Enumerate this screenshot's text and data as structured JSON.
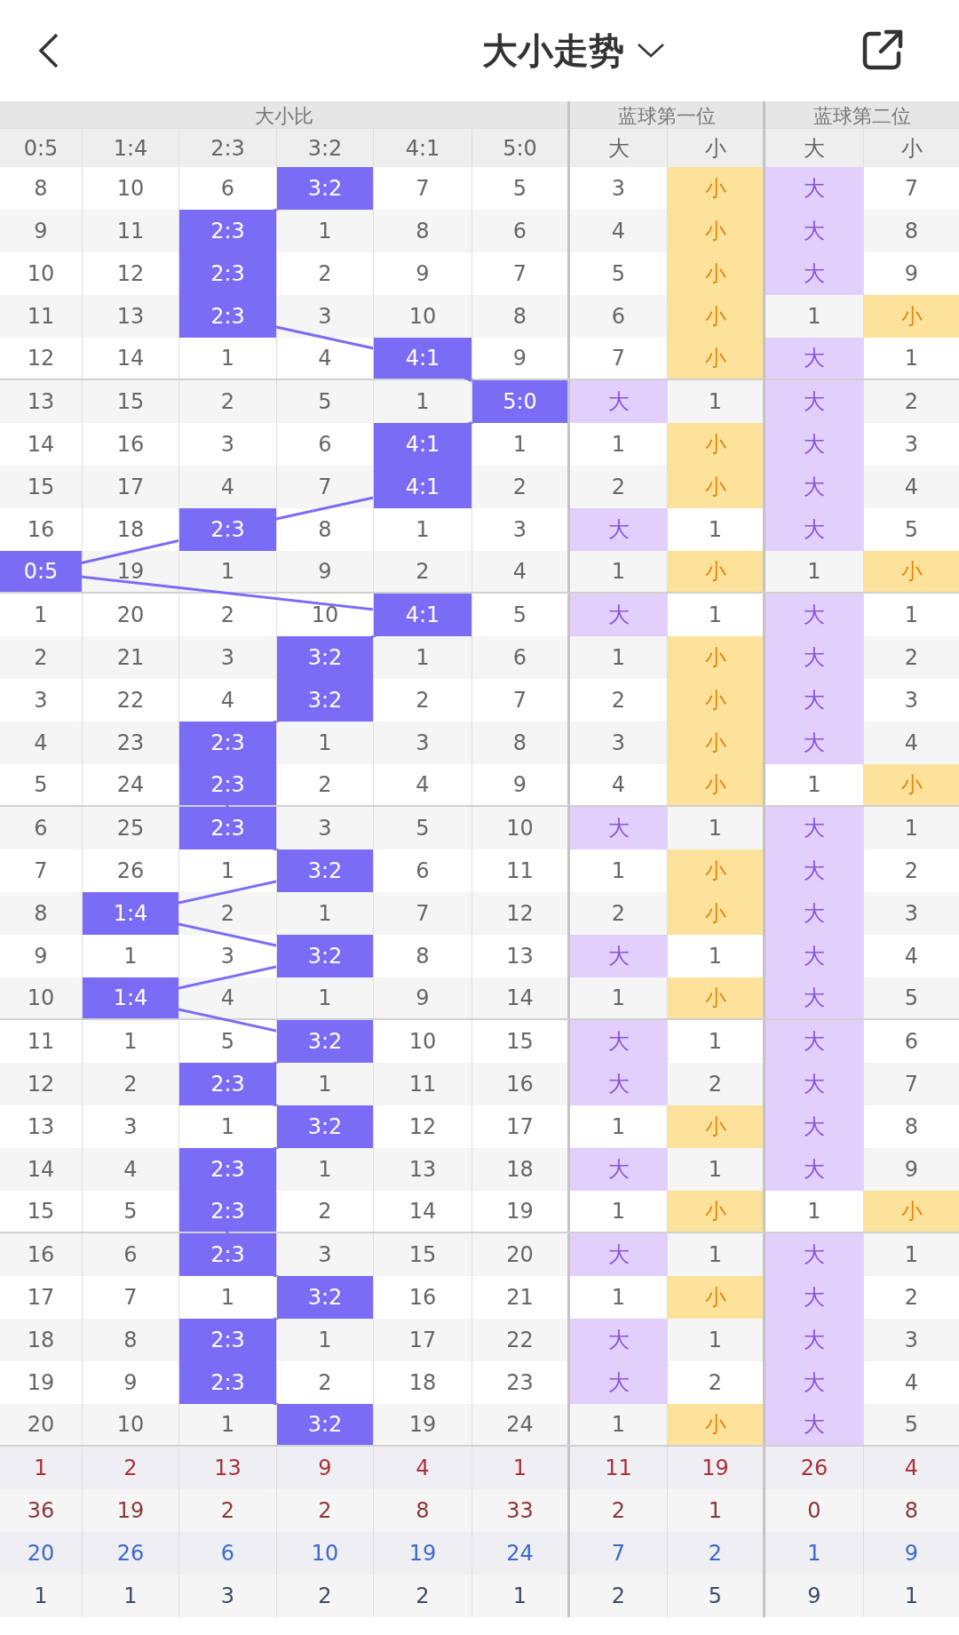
{
  "header": {
    "title": "大小走势"
  },
  "groups": [
    {
      "label": "大小比",
      "kind": "ratio"
    },
    {
      "label": "蓝球第一位",
      "kind": "position"
    },
    {
      "label": "蓝球第二位",
      "kind": "position"
    }
  ],
  "columns": [
    "0:5",
    "1:4",
    "2:3",
    "3:2",
    "4:1",
    "5:0",
    "大",
    "小",
    "大",
    "小"
  ],
  "rows": [
    {
      "cells": [
        "8",
        "10",
        "6",
        "3:2",
        "7",
        "5",
        "3",
        "小",
        "大",
        "7"
      ],
      "hits": [
        false,
        false,
        false,
        true,
        false,
        false,
        false,
        true,
        true,
        false
      ]
    },
    {
      "cells": [
        "9",
        "11",
        "2:3",
        "1",
        "8",
        "6",
        "4",
        "小",
        "大",
        "8"
      ],
      "hits": [
        false,
        false,
        true,
        false,
        false,
        false,
        false,
        true,
        true,
        false
      ]
    },
    {
      "cells": [
        "10",
        "12",
        "2:3",
        "2",
        "9",
        "7",
        "5",
        "小",
        "大",
        "9"
      ],
      "hits": [
        false,
        false,
        true,
        false,
        false,
        false,
        false,
        true,
        true,
        false
      ]
    },
    {
      "cells": [
        "11",
        "13",
        "2:3",
        "3",
        "10",
        "8",
        "6",
        "小",
        "1",
        "小"
      ],
      "hits": [
        false,
        false,
        true,
        false,
        false,
        false,
        false,
        true,
        false,
        true
      ]
    },
    {
      "cells": [
        "12",
        "14",
        "1",
        "4",
        "4:1",
        "9",
        "7",
        "小",
        "大",
        "1"
      ],
      "hits": [
        false,
        false,
        false,
        false,
        true,
        false,
        false,
        true,
        true,
        false
      ]
    },
    {
      "cells": [
        "13",
        "15",
        "2",
        "5",
        "1",
        "5:0",
        "大",
        "1",
        "大",
        "2"
      ],
      "hits": [
        false,
        false,
        false,
        false,
        false,
        true,
        true,
        false,
        true,
        false
      ]
    },
    {
      "cells": [
        "14",
        "16",
        "3",
        "6",
        "4:1",
        "1",
        "1",
        "小",
        "大",
        "3"
      ],
      "hits": [
        false,
        false,
        false,
        false,
        true,
        false,
        false,
        true,
        true,
        false
      ]
    },
    {
      "cells": [
        "15",
        "17",
        "4",
        "7",
        "4:1",
        "2",
        "2",
        "小",
        "大",
        "4"
      ],
      "hits": [
        false,
        false,
        false,
        false,
        true,
        false,
        false,
        true,
        true,
        false
      ]
    },
    {
      "cells": [
        "16",
        "18",
        "2:3",
        "8",
        "1",
        "3",
        "大",
        "1",
        "大",
        "5"
      ],
      "hits": [
        false,
        false,
        true,
        false,
        false,
        false,
        true,
        false,
        true,
        false
      ]
    },
    {
      "cells": [
        "0:5",
        "19",
        "1",
        "9",
        "2",
        "4",
        "1",
        "小",
        "1",
        "小"
      ],
      "hits": [
        true,
        false,
        false,
        false,
        false,
        false,
        false,
        true,
        false,
        true
      ]
    },
    {
      "cells": [
        "1",
        "20",
        "2",
        "10",
        "4:1",
        "5",
        "大",
        "1",
        "大",
        "1"
      ],
      "hits": [
        false,
        false,
        false,
        false,
        true,
        false,
        true,
        false,
        true,
        false
      ]
    },
    {
      "cells": [
        "2",
        "21",
        "3",
        "3:2",
        "1",
        "6",
        "1",
        "小",
        "大",
        "2"
      ],
      "hits": [
        false,
        false,
        false,
        true,
        false,
        false,
        false,
        true,
        true,
        false
      ]
    },
    {
      "cells": [
        "3",
        "22",
        "4",
        "3:2",
        "2",
        "7",
        "2",
        "小",
        "大",
        "3"
      ],
      "hits": [
        false,
        false,
        false,
        true,
        false,
        false,
        false,
        true,
        true,
        false
      ]
    },
    {
      "cells": [
        "4",
        "23",
        "2:3",
        "1",
        "3",
        "8",
        "3",
        "小",
        "大",
        "4"
      ],
      "hits": [
        false,
        false,
        true,
        false,
        false,
        false,
        false,
        true,
        true,
        false
      ]
    },
    {
      "cells": [
        "5",
        "24",
        "2:3",
        "2",
        "4",
        "9",
        "4",
        "小",
        "1",
        "小"
      ],
      "hits": [
        false,
        false,
        true,
        false,
        false,
        false,
        false,
        true,
        false,
        true
      ]
    },
    {
      "cells": [
        "6",
        "25",
        "2:3",
        "3",
        "5",
        "10",
        "大",
        "1",
        "大",
        "1"
      ],
      "hits": [
        false,
        false,
        true,
        false,
        false,
        false,
        true,
        false,
        true,
        false
      ]
    },
    {
      "cells": [
        "7",
        "26",
        "1",
        "3:2",
        "6",
        "11",
        "1",
        "小",
        "大",
        "2"
      ],
      "hits": [
        false,
        false,
        false,
        true,
        false,
        false,
        false,
        true,
        true,
        false
      ]
    },
    {
      "cells": [
        "8",
        "1:4",
        "2",
        "1",
        "7",
        "12",
        "2",
        "小",
        "大",
        "3"
      ],
      "hits": [
        false,
        true,
        false,
        false,
        false,
        false,
        false,
        true,
        true,
        false
      ]
    },
    {
      "cells": [
        "9",
        "1",
        "3",
        "3:2",
        "8",
        "13",
        "大",
        "1",
        "大",
        "4"
      ],
      "hits": [
        false,
        false,
        false,
        true,
        false,
        false,
        true,
        false,
        true,
        false
      ]
    },
    {
      "cells": [
        "10",
        "1:4",
        "4",
        "1",
        "9",
        "14",
        "1",
        "小",
        "大",
        "5"
      ],
      "hits": [
        false,
        true,
        false,
        false,
        false,
        false,
        false,
        true,
        true,
        false
      ]
    },
    {
      "cells": [
        "11",
        "1",
        "5",
        "3:2",
        "10",
        "15",
        "大",
        "1",
        "大",
        "6"
      ],
      "hits": [
        false,
        false,
        false,
        true,
        false,
        false,
        true,
        false,
        true,
        false
      ]
    },
    {
      "cells": [
        "12",
        "2",
        "2:3",
        "1",
        "11",
        "16",
        "大",
        "2",
        "大",
        "7"
      ],
      "hits": [
        false,
        false,
        true,
        false,
        false,
        false,
        true,
        false,
        true,
        false
      ]
    },
    {
      "cells": [
        "13",
        "3",
        "1",
        "3:2",
        "12",
        "17",
        "1",
        "小",
        "大",
        "8"
      ],
      "hits": [
        false,
        false,
        false,
        true,
        false,
        false,
        false,
        true,
        true,
        false
      ]
    },
    {
      "cells": [
        "14",
        "4",
        "2:3",
        "1",
        "13",
        "18",
        "大",
        "1",
        "大",
        "9"
      ],
      "hits": [
        false,
        false,
        true,
        false,
        false,
        false,
        true,
        false,
        true,
        false
      ]
    },
    {
      "cells": [
        "15",
        "5",
        "2:3",
        "2",
        "14",
        "19",
        "1",
        "小",
        "1",
        "小"
      ],
      "hits": [
        false,
        false,
        true,
        false,
        false,
        false,
        false,
        true,
        false,
        true
      ]
    },
    {
      "cells": [
        "16",
        "6",
        "2:3",
        "3",
        "15",
        "20",
        "大",
        "1",
        "大",
        "1"
      ],
      "hits": [
        false,
        false,
        true,
        false,
        false,
        false,
        true,
        false,
        true,
        false
      ]
    },
    {
      "cells": [
        "17",
        "7",
        "1",
        "3:2",
        "16",
        "21",
        "1",
        "小",
        "大",
        "2"
      ],
      "hits": [
        false,
        false,
        false,
        true,
        false,
        false,
        false,
        true,
        true,
        false
      ]
    },
    {
      "cells": [
        "18",
        "8",
        "2:3",
        "1",
        "17",
        "22",
        "大",
        "1",
        "大",
        "3"
      ],
      "hits": [
        false,
        false,
        true,
        false,
        false,
        false,
        true,
        false,
        true,
        false
      ]
    },
    {
      "cells": [
        "19",
        "9",
        "2:3",
        "2",
        "18",
        "23",
        "大",
        "2",
        "大",
        "4"
      ],
      "hits": [
        false,
        false,
        true,
        false,
        false,
        false,
        true,
        false,
        true,
        false
      ]
    },
    {
      "cells": [
        "20",
        "10",
        "1",
        "3:2",
        "19",
        "24",
        "1",
        "小",
        "大",
        "5"
      ],
      "hits": [
        false,
        false,
        false,
        true,
        false,
        false,
        false,
        true,
        true,
        false
      ]
    }
  ],
  "stats": [
    {
      "color": "#a8323a",
      "cells": [
        "1",
        "2",
        "13",
        "9",
        "4",
        "1",
        "11",
        "19",
        "26",
        "4"
      ]
    },
    {
      "color": "#8b3a3a",
      "cells": [
        "36",
        "19",
        "2",
        "2",
        "8",
        "33",
        "2",
        "1",
        "0",
        "8"
      ]
    },
    {
      "color": "#3a6ad0",
      "cells": [
        "20",
        "26",
        "6",
        "10",
        "19",
        "24",
        "7",
        "2",
        "1",
        "9"
      ]
    },
    {
      "color": "#3f4a66",
      "cells": [
        "1",
        "1",
        "3",
        "2",
        "2",
        "1",
        "2",
        "5",
        "9",
        "1"
      ]
    }
  ]
}
